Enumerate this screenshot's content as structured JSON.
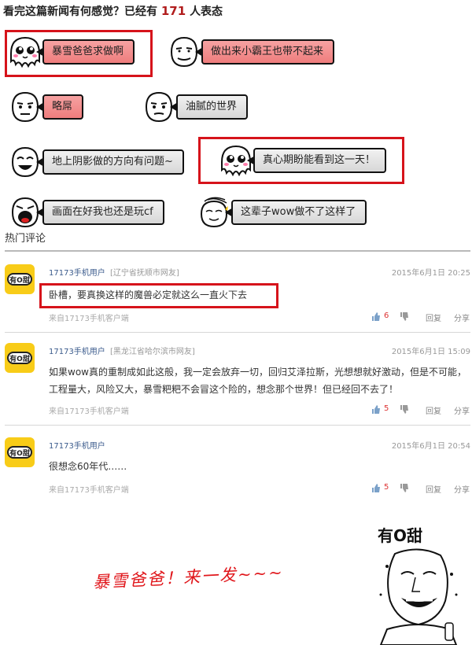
{
  "header": {
    "prefix": "看完这篇新闻有何感觉？已经有",
    "count": "171",
    "suffix": "人表态"
  },
  "reactions": [
    {
      "label": "暴雪爸爸求做啊",
      "face": "octopus-face-icon",
      "style": "pink"
    },
    {
      "label": "做出来小霸王也带不起来",
      "face": "smug-face-icon",
      "style": "pink"
    },
    {
      "label": "略屌",
      "face": "stare-face-icon",
      "style": "pink"
    },
    {
      "label": "油腻的世界",
      "face": "stare-face-icon",
      "style": "grey"
    },
    {
      "label": "地上阴影做的方向有问题~",
      "face": "laugh-face-icon",
      "style": "grey"
    },
    {
      "label": "真心期盼能看到这一天！",
      "face": "octopus-face-icon",
      "style": "grey"
    },
    {
      "label": "画面在好我也还是玩cf",
      "face": "shout-face-icon",
      "style": "grey"
    },
    {
      "label": "这辈子wow做不了这样了",
      "face": "shy-face-icon",
      "style": "grey"
    }
  ],
  "section_title": "热门评论",
  "comments": [
    {
      "user": "17173手机用户",
      "location": "[辽宁省抚顺市网友]",
      "time": "2015年6月1日 20:25",
      "text": "卧槽，要真换这样的魔兽必定就这么一直火下去",
      "source": "来自17173手机客户端",
      "likes": "6",
      "reply": "回复",
      "share": "分享"
    },
    {
      "user": "17173手机用户",
      "location": "[黑龙江省哈尔滨市网友]",
      "time": "2015年6月1日 15:09",
      "text": "如果wow真的重制成如此这般，我一定会放弃一切，回归艾泽拉斯，光想想就好激动，但是不可能，工程量大，风险又大，暴雪粑粑不会冒这个险的，想念那个世界！但已经回不去了！",
      "source": "来自17173手机客户端",
      "likes": "5",
      "reply": "回复",
      "share": "分享"
    },
    {
      "user": "17173手机用户",
      "location": "",
      "time": "2015年6月1日 20:54",
      "text": "很想念60年代……",
      "source": "来自17173手机客户端",
      "likes": "5",
      "reply": "回复",
      "share": "分享"
    }
  ],
  "avatar_text": "有O甜",
  "slogan": "暴雪爸爸！来一发~~~",
  "meme_caption": "有O甜",
  "colors": {
    "accent": "#b11d1d",
    "highlight": "#d6131b",
    "avatar": "#f8cc18"
  }
}
